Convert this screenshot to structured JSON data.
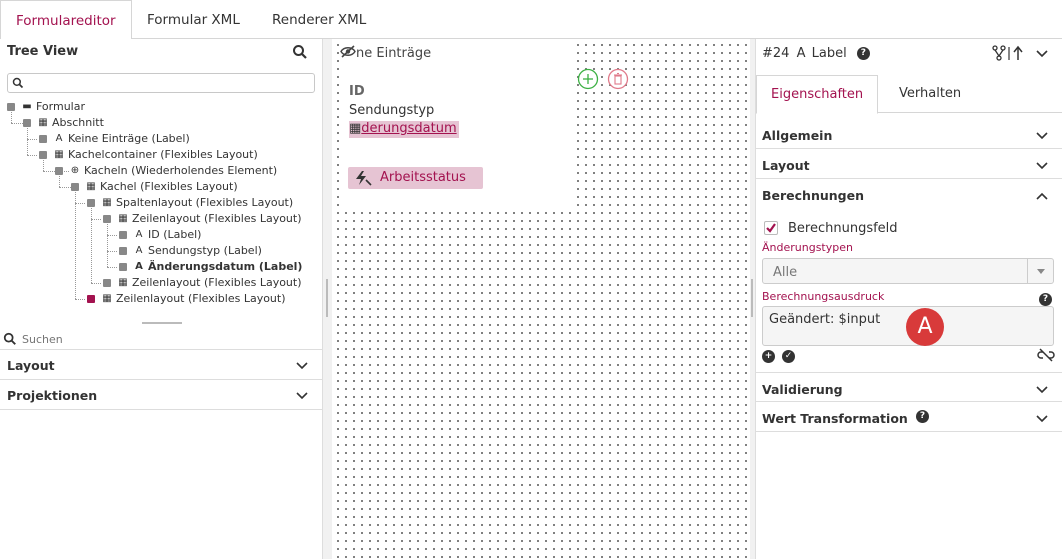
{
  "top_tabs": [
    "Formulareditor",
    "Formular XML",
    "Renderer XML"
  ],
  "tree_view": {
    "title": "Tree View",
    "nodes": [
      "Formular",
      "Abschnitt",
      "Keine Einträge (Label)",
      "Kachelcontainer (Flexibles Layout)",
      "Kacheln (Wiederholendes Element)",
      "Kachel (Flexibles Layout)",
      "Spaltenlayout (Flexibles Layout)",
      "Zeilenlayout (Flexibles Layout)",
      "ID (Label)",
      "Sendungstyp (Label)",
      "Änderungsdatum (Label)",
      "Zeilenlayout (Flexibles Layout)",
      "Zeilenlayout (Flexibles Layout)"
    ]
  },
  "search": {
    "placeholder": "Suchen"
  },
  "left_accordions": [
    "Layout",
    "Projektionen"
  ],
  "canvas": {
    "hidden_label": "ne Einträge",
    "id_label": "ID",
    "typ_label": "Sendungstyp",
    "datum_label": "derungsdatum",
    "status_label": "Arbeitsstatus"
  },
  "props": {
    "header_id": "#24",
    "header_type": "Label",
    "tabs": [
      "Eigenschaften",
      "Verhalten"
    ],
    "sections": [
      "Allgemein",
      "Layout",
      "Berechnungen",
      "Validierung",
      "Wert Transformation"
    ],
    "berechnungsfeld_label": "Berechnungsfeld",
    "aenderungstypen_label": "Änderungstypen",
    "aenderungstypen_value": "Alle",
    "ausdruck_label": "Berechnungsausdruck",
    "ausdruck_value": "Geändert: $input",
    "badge": "A"
  },
  "colors": {
    "accent": "#a3124f",
    "highlight": "#e6c4d3",
    "badge": "#d83a3a"
  }
}
